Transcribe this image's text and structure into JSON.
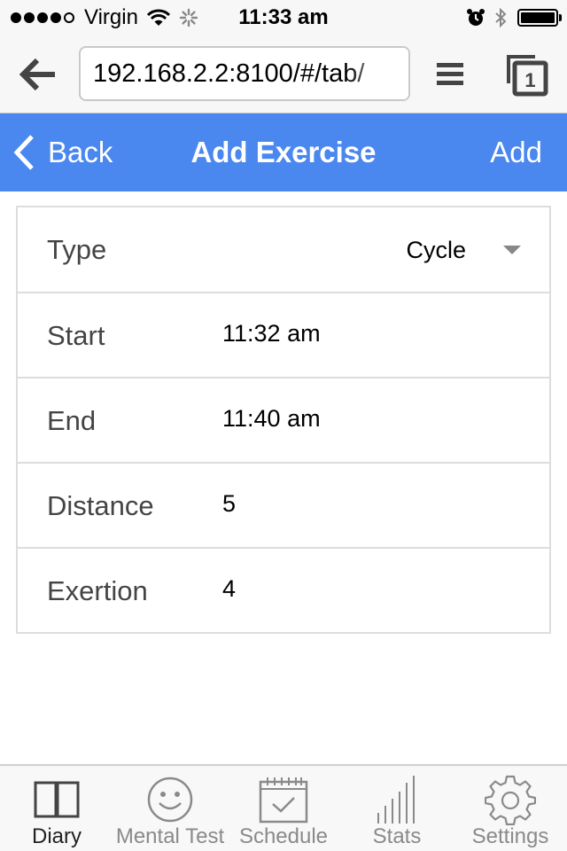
{
  "status_bar": {
    "carrier": "Virgin",
    "time": "11:33 am",
    "signal_bars": 4,
    "signal_max": 5,
    "battery_level": 1.0
  },
  "browser": {
    "url": "192.168.2.2:8100/#/tab/",
    "tab_count": "1"
  },
  "header": {
    "back_label": "Back",
    "title": "Add Exercise",
    "action_label": "Add"
  },
  "form": {
    "type_label": "Type",
    "type_value": "Cycle",
    "start_label": "Start",
    "start_value": "11:32 am",
    "end_label": "End",
    "end_value": "11:40 am",
    "distance_label": "Distance",
    "distance_value": "5",
    "exertion_label": "Exertion",
    "exertion_value": "4"
  },
  "tabs": [
    {
      "label": "Diary",
      "icon": "book-icon",
      "active": true
    },
    {
      "label": "Mental Test",
      "icon": "smiley-icon",
      "active": false
    },
    {
      "label": "Schedule",
      "icon": "calendar-icon",
      "active": false
    },
    {
      "label": "Stats",
      "icon": "bar-chart-icon",
      "active": false
    },
    {
      "label": "Settings",
      "icon": "gear-icon",
      "active": false
    }
  ],
  "colors": {
    "header_bg": "#4a87ee",
    "header_text": "#ffffff",
    "active_tab": "#222222",
    "inactive_tab": "#8a8a8a"
  }
}
